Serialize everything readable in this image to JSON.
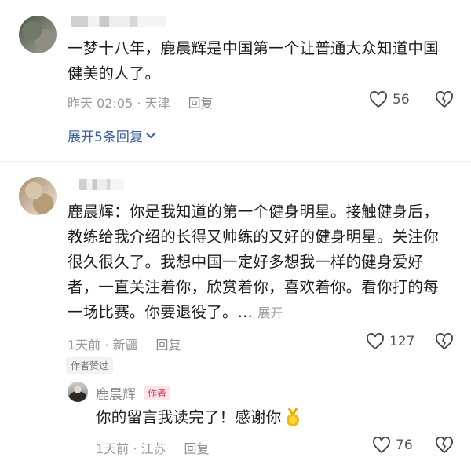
{
  "comments": [
    {
      "content_line1": "一梦十八年，鹿晨辉是中国第一个让普通大众知道中国",
      "content_line2": "健美的人了。",
      "time_location": "昨天 02:05 · 天津",
      "reply_label": "回复",
      "likes": "56",
      "expand_replies": "展开5条回复"
    },
    {
      "content_lines": [
        "鹿晨辉：你是我知道的第一个健身明星。接触健身后，",
        "教练给我介绍的长得又帅练的又好的健身明星。关注你",
        "很久很久了。我想中国一定好多想我一样的健身爱好",
        "者，一直关注着你，欣赏着你，喜欢着你。看你打的每",
        "一场比赛。你要退役了。..."
      ],
      "more_label": "展开",
      "time_location": "1天前 · 新疆",
      "reply_label": "回复",
      "likes": "127",
      "author_liked": "作者赞过",
      "reply": {
        "name": "鹿晨辉",
        "author_tag": "作者",
        "content": "你的留言我读完了！感谢你",
        "time_location": "1天前 · 江苏",
        "reply_label": "回复",
        "likes": "76"
      }
    }
  ],
  "icons": {
    "heart": "heart-icon",
    "dislike": "broken-heart-icon",
    "chevron": "chevron-down-icon",
    "medal": "medal-emoji-icon"
  }
}
